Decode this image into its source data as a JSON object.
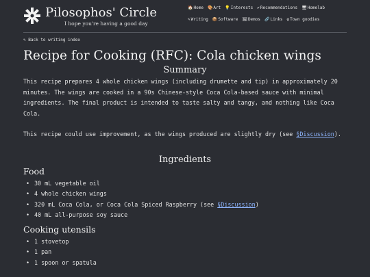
{
  "site": {
    "title": "Pilosophos' Circle",
    "tagline": "I hope you're having a good day"
  },
  "nav": {
    "row1": [
      {
        "icon": "🏠",
        "label": "Home",
        "name": "nav-home"
      },
      {
        "icon": "🎨",
        "label": "Art",
        "name": "nav-art"
      },
      {
        "icon": "💡",
        "label": "Interests",
        "name": "nav-interests"
      },
      {
        "icon": "✔",
        "label": "Recommendations",
        "name": "nav-recommendations"
      },
      {
        "icon": "🖥",
        "label": "Homelab",
        "name": "nav-homelab"
      }
    ],
    "row2": [
      {
        "icon": "✎",
        "label": "Writing",
        "name": "nav-writing"
      },
      {
        "icon": "📦",
        "label": "Software",
        "name": "nav-software"
      },
      {
        "icon": "🖼",
        "label": "Demos",
        "name": "nav-demos"
      },
      {
        "icon": "🔗",
        "label": "Links",
        "name": "nav-links"
      },
      {
        "icon": "✿",
        "label": "Town goodies",
        "name": "nav-town-goodies"
      }
    ]
  },
  "back_link": {
    "icon": "✎",
    "label": "Back to writing index"
  },
  "article": {
    "title": "Recipe for Cooking (RFC): Cola chicken wings",
    "summary_heading": "Summary",
    "summary_p1": "This recipe prepares 4 whole chicken wings (including drumette and tip) in approximately 20 minutes. The wings are cooked in a 90s Chinese-style Coca Cola-based sauce with minimal ingredients. The final product is intended to taste salty and tangy, and nothing like Coca Cola.",
    "summary_p2_before": "This recipe could use improvement, as the wings produced are slightly dry (see ",
    "summary_p2_link": "§Discussion",
    "summary_p2_after": ").",
    "ingredients_heading": "Ingredients",
    "food_heading": "Food",
    "food": [
      {
        "text": "30 mL vegetable oil"
      },
      {
        "text": "4 whole chicken wings"
      },
      {
        "text": "320 mL Coca Cola, or Coca Cola Spiced Raspberry (see ",
        "link": "§Discussion",
        "after": ")"
      },
      {
        "text": "40 mL all-purpose soy sauce"
      }
    ],
    "utensils_heading": "Cooking utensils",
    "utensils": [
      "1 stovetop",
      "1 pan",
      "1 spoon or spatula"
    ]
  }
}
